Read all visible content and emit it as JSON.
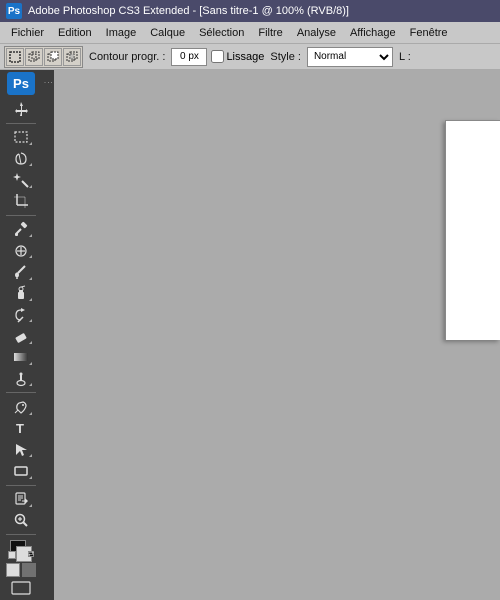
{
  "titleBar": {
    "title": "Adobe Photoshop CS3 Extended - [Sans titre-1 @ 100% (RVB/8)]",
    "logo": "Ps"
  },
  "menuBar": {
    "items": [
      {
        "id": "fichier",
        "label": "Fichier"
      },
      {
        "id": "edition",
        "label": "Edition"
      },
      {
        "id": "image",
        "label": "Image"
      },
      {
        "id": "calque",
        "label": "Calque"
      },
      {
        "id": "selection",
        "label": "Sélection"
      },
      {
        "id": "filtre",
        "label": "Filtre"
      },
      {
        "id": "analyse",
        "label": "Analyse"
      },
      {
        "id": "affichage",
        "label": "Affichage"
      },
      {
        "id": "fenetre",
        "label": "Fenêtre"
      }
    ]
  },
  "optionsBar": {
    "contourLabel": "Contour progr. :",
    "contourValue": "0 px",
    "lissageLabel": "Lissage",
    "styleLabel": "Style :",
    "styleValue": "Normal",
    "extraValue": "L :"
  },
  "toolbar": {
    "tools": [
      {
        "id": "move",
        "icon": "✣",
        "label": "move-tool"
      },
      {
        "id": "select-rect",
        "icon": "⬚",
        "label": "selection-rect-tool"
      },
      {
        "id": "lasso",
        "icon": "⌀",
        "label": "lasso-tool"
      },
      {
        "id": "magic-wand",
        "icon": "✦",
        "label": "magic-wand-tool"
      },
      {
        "id": "crop",
        "icon": "⊡",
        "label": "crop-tool"
      },
      {
        "id": "eyedropper",
        "icon": "✒",
        "label": "eyedropper-tool"
      },
      {
        "id": "heal",
        "icon": "⊕",
        "label": "heal-tool"
      },
      {
        "id": "brush",
        "icon": "✏",
        "label": "brush-tool"
      },
      {
        "id": "stamp",
        "icon": "⊞",
        "label": "stamp-tool"
      },
      {
        "id": "history-brush",
        "icon": "↶",
        "label": "history-brush-tool"
      },
      {
        "id": "eraser",
        "icon": "◻",
        "label": "eraser-tool"
      },
      {
        "id": "gradient",
        "icon": "▦",
        "label": "gradient-tool"
      },
      {
        "id": "dodge",
        "icon": "○",
        "label": "dodge-tool"
      },
      {
        "id": "pen",
        "icon": "✒",
        "label": "pen-tool"
      },
      {
        "id": "type",
        "icon": "T",
        "label": "type-tool"
      },
      {
        "id": "path-select",
        "icon": "↖",
        "label": "path-select-tool"
      },
      {
        "id": "shape",
        "icon": "◻",
        "label": "shape-tool"
      },
      {
        "id": "notes",
        "icon": "✎",
        "label": "notes-tool"
      },
      {
        "id": "zoom",
        "icon": "🔍",
        "label": "zoom-tool"
      }
    ]
  },
  "canvas": {
    "backgroundColor": "#ababab"
  }
}
